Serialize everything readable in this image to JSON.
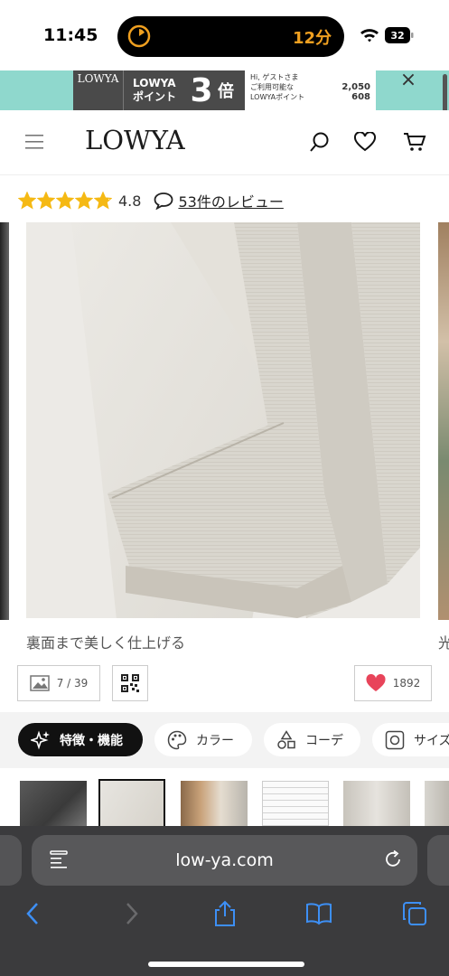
{
  "status_bar": {
    "time": "11:45",
    "timer_text": "12分",
    "battery_level": "32"
  },
  "banner": {
    "logo": "LOWYA",
    "line1": "LOWYA",
    "line2": "ポイント",
    "multiplier": "3",
    "multiplier_unit": "倍",
    "card_greeting": "Hi, ゲストさま",
    "card_row1_label": "ご利用可能な",
    "card_row1_value": "2,050",
    "card_row2_label": "LOWYAポイント",
    "card_row2_value": "608",
    "close_label": "×"
  },
  "header": {
    "logo": "LOWYA",
    "icons": [
      "menu-icon",
      "search-icon",
      "heart-icon",
      "cart-icon"
    ]
  },
  "rating": {
    "value": "4.8",
    "stars": 4.8,
    "review_link": "53件のレビュー"
  },
  "gallery": {
    "caption": "裏面まで美しく仕上げる",
    "next_caption": "光",
    "counter": "7 / 39",
    "favorites": "1892"
  },
  "tabs": [
    {
      "label": "特徴・機能",
      "icon": "sparkle-icon",
      "active": true
    },
    {
      "label": "カラー",
      "icon": "palette-icon",
      "active": false
    },
    {
      "label": "コーデ",
      "icon": "shapes-icon",
      "active": false
    },
    {
      "label": "サイズ",
      "icon": "tape-icon",
      "active": false
    }
  ],
  "browser": {
    "url": "low-ya.com"
  },
  "colors": {
    "banner_bg": "#8fd8cd",
    "star": "#f5b914",
    "heart": "#e8445a",
    "active_tab": "#111111",
    "browser_bg": "#3b3b3d",
    "toolbar_icon": "#3d8ff5"
  }
}
